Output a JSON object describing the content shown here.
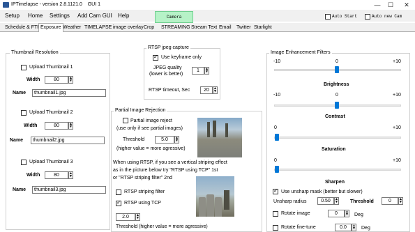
{
  "window": {
    "title": "IPTimelapse - version 2.8.1121.0    GUI 1",
    "minimize": "—",
    "maximize": "☐",
    "close": "✕"
  },
  "menu": {
    "items": [
      "Setup",
      "Home",
      "Settings",
      "Add Cam GUI",
      "Help"
    ],
    "camera_button": "Camera",
    "auto_start": "Auto Start",
    "auto_new_cam": "Auto new Cam"
  },
  "tabs": [
    "Schedule & FTP",
    "Exposure",
    "Weather",
    "TIMELAPSE",
    "image overlay",
    "Crop",
    "STREAMING",
    "Stream Text",
    "Email",
    "Twitter",
    "Starlight"
  ],
  "active_tab": "Exposure",
  "thumbnail": {
    "group_title": "Thumbnail Resolution",
    "items": [
      {
        "checkbox": "Upload Thumbnail 1",
        "width_label": "Width",
        "width": "80",
        "name_label": "Name",
        "name": "thumbnail1.jpg"
      },
      {
        "checkbox": "Upload Thumbnail 2",
        "width_label": "Width",
        "width": "80",
        "name_label": "Name",
        "name": "thumbnail2.jpg"
      },
      {
        "checkbox": "Upload Thumbnail 3",
        "width_label": "Width",
        "width": "80",
        "name_label": "Name",
        "name": "thumbnail3.jpg"
      }
    ]
  },
  "rtsp": {
    "group_title": "RTSP jpeg capture",
    "use_keyframe": "Use keyframe only",
    "jpeg_quality_line1": "JPEG quality",
    "jpeg_quality_line2": "(lower is better)",
    "jpeg_quality": "1",
    "timeout_label": "RTSP timeout, Sec",
    "timeout": "20"
  },
  "partial": {
    "group_title": "Partial Image Rejection",
    "reject_label": "Partial image reject",
    "reject_note": "(use only if see partial images)",
    "threshold_label": "Threshold",
    "threshold": "5.0",
    "threshold_note": "(higher value = more agressive)",
    "info1": "When using RTSP, if you see a vertical striping effect",
    "info2": "as in the picture below try \"RTSP using TCP\" 1st",
    "info3": "or \"RTSP striping filter\" 2nd",
    "striping_filter": "RTSP striping filter",
    "using_tcp": "RTSP using TCP",
    "striping_value": "2.0",
    "striping_note": "Threshold (higher value = more agressive)"
  },
  "enhance": {
    "group_title": "Image Enhancement Filters",
    "sliders": [
      {
        "min": "-10",
        "mid": "0",
        "max": "+10",
        "label": "Brightness",
        "value": 0
      },
      {
        "min": "-10",
        "mid": "0",
        "max": "+10",
        "label": "Contrast",
        "value": 0
      },
      {
        "min": "0",
        "mid": "",
        "max": "+10",
        "label": "Saturation",
        "value": 0
      },
      {
        "min": "0",
        "mid": "",
        "max": "+10",
        "label": "Sharpen",
        "value": 0
      }
    ],
    "unsharp": "Use unsharp mask (better but slower)",
    "unsharp_radius_label": "Unsharp radius",
    "unsharp_radius": "0.50",
    "threshold_label": "Threshold",
    "threshold": "0",
    "rotate_label": "Rotate image",
    "rotate": "0",
    "rotate_unit": "Deg",
    "rotate_fine_label": "Rotate fine-tune",
    "rotate_fine": "0.0",
    "rotate_fine_unit": "Deg"
  }
}
